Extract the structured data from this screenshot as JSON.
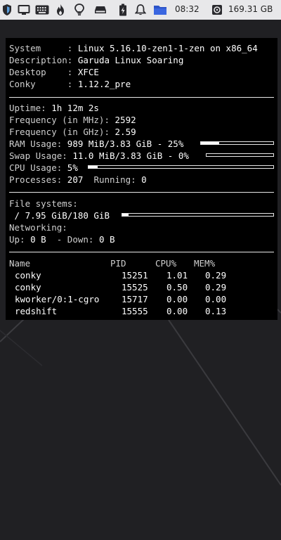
{
  "panel": {
    "clock": "08:32",
    "disk_free": "169.31 GB",
    "icons": [
      "shield-icon",
      "display-icon",
      "keyboard-icon",
      "flame-icon",
      "lightbulb-icon",
      "drive-icon",
      "battery-icon",
      "bell-icon",
      "folder-icon",
      "disk-icon"
    ]
  },
  "conky": {
    "system_info": [
      {
        "label": "System     : ",
        "value": "Linux 5.16.10-zen1-1-zen on x86_64"
      },
      {
        "label": "Description: ",
        "value": "Garuda Linux Soaring"
      },
      {
        "label": "Desktop    : ",
        "value": "XFCE"
      },
      {
        "label": "Conky      : ",
        "value": "1.12.2_pre"
      }
    ],
    "uptime": {
      "label": "Uptime: ",
      "value": "1h 12m 2s"
    },
    "freq_mhz": {
      "label": "Frequency (in MHz): ",
      "value": "2592"
    },
    "freq_ghz": {
      "label": "Frequency (in GHz): ",
      "value": "2.59"
    },
    "ram": {
      "label": "RAM Usage: ",
      "value": "989 MiB/3.83 GiB - 25%",
      "fraction": 0.25
    },
    "swap": {
      "label": "Swap Usage: ",
      "value": "11.0 MiB/3.83 GiB - 0%",
      "fraction": 0.0
    },
    "cpu": {
      "label": "CPU Usage: ",
      "value": "5%",
      "fraction": 0.05
    },
    "processes": {
      "label": "Processes: ",
      "value": "207",
      "running_label": "Running: ",
      "running_value": "0"
    },
    "filesystems": {
      "label": "File systems:",
      "mount": " / ",
      "value": "7.95 GiB/180 GiB",
      "fraction": 0.044
    },
    "networking": {
      "label": "Networking:",
      "up_label": "Up: ",
      "up_value": "0 B",
      "down_label": "  - Down: ",
      "down_value": "0 B"
    },
    "process_table": {
      "headers": {
        "name": "Name",
        "pid": "PID",
        "cpu": "CPU%",
        "mem": "MEM%"
      },
      "rows": [
        {
          "name": "conky",
          "pid": "15251",
          "cpu": "1.01",
          "mem": "0.29"
        },
        {
          "name": "conky",
          "pid": "15525",
          "cpu": "0.50",
          "mem": "0.29"
        },
        {
          "name": "kworker/0:1-cgro",
          "pid": "15717",
          "cpu": "0.00",
          "mem": "0.00"
        },
        {
          "name": "redshift",
          "pid": "15555",
          "cpu": "0.00",
          "mem": "0.13"
        }
      ]
    }
  }
}
